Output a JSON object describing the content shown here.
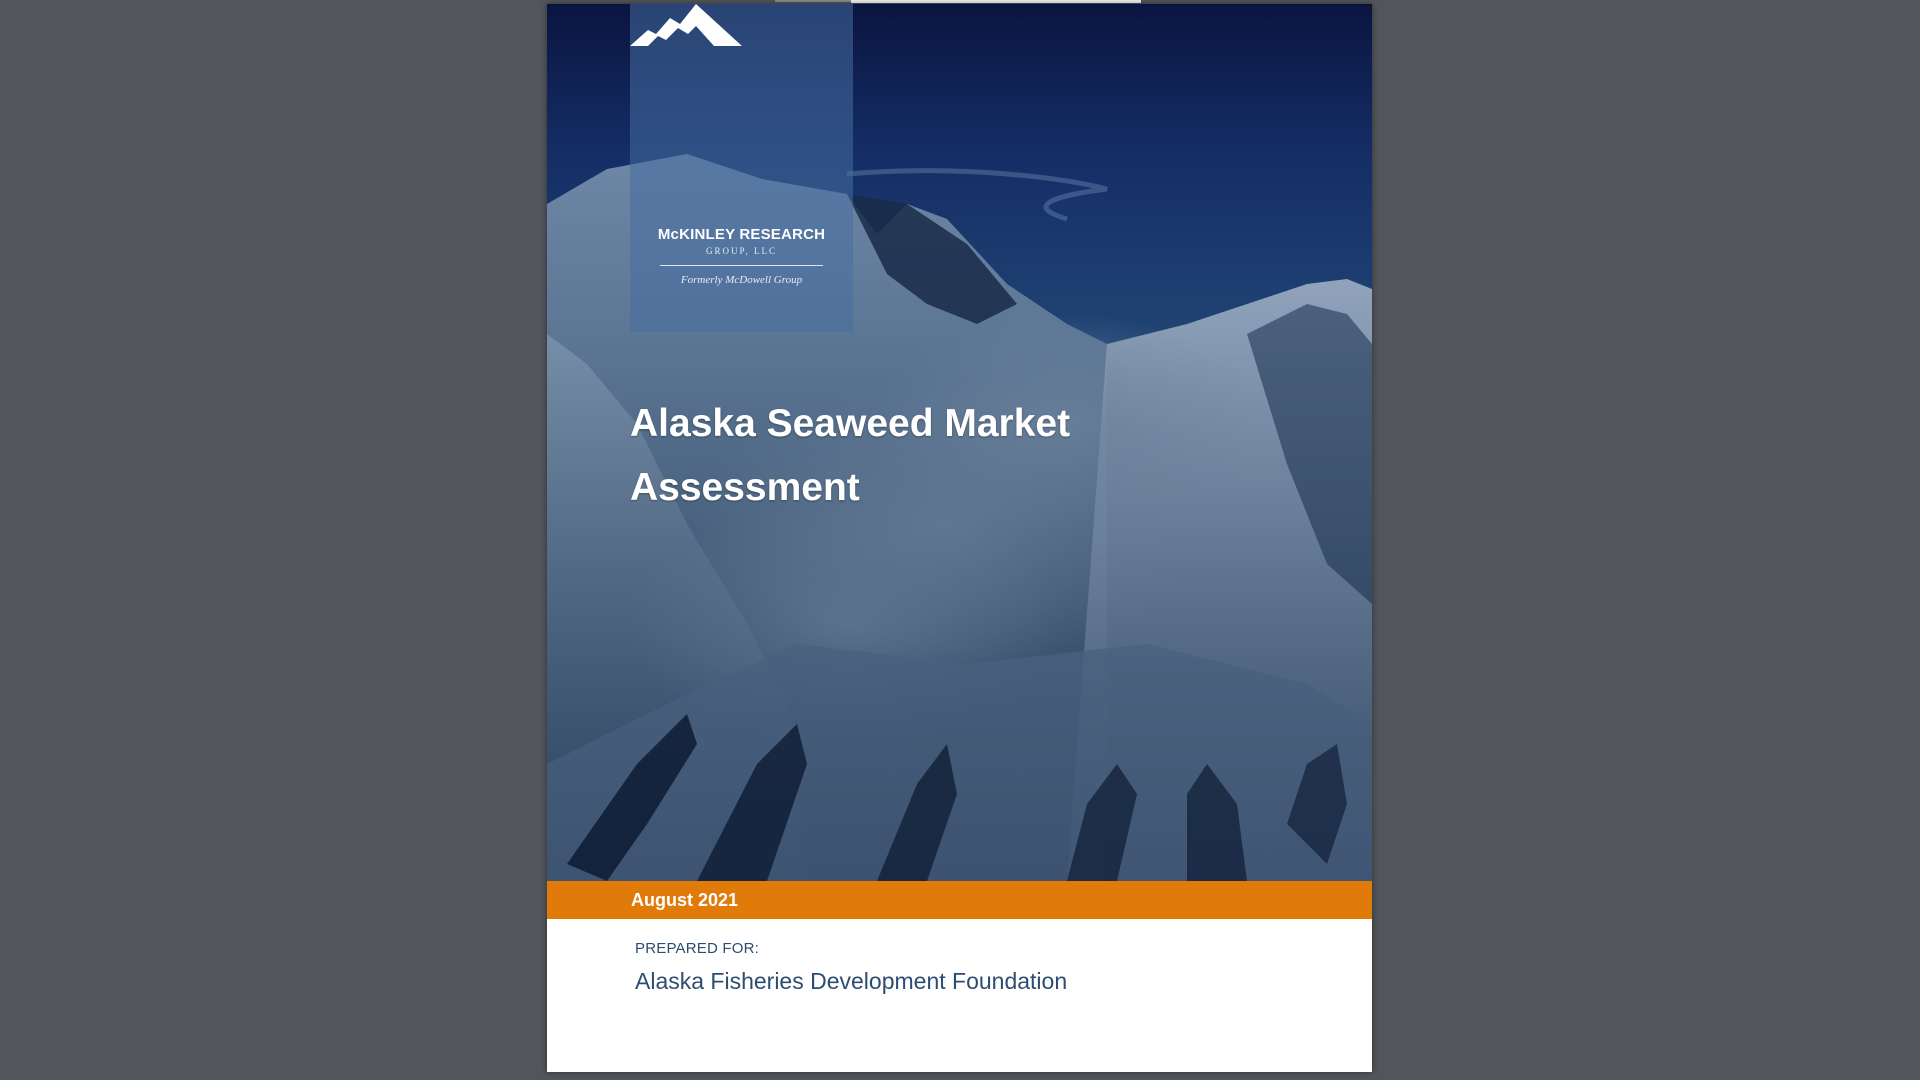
{
  "colors": {
    "viewer_background": "#52565a",
    "accent_orange": "#e07b0a",
    "text_navy": "#2d4d70",
    "cover_sky": "#0a1440"
  },
  "logo": {
    "icon": "mountain-logo-icon",
    "name": "McKINLEY RESEARCH",
    "subtitle": "GROUP, LLC",
    "formerly": "Formerly McDowell Group"
  },
  "cover": {
    "title_line1": "Alaska Seaweed Market",
    "title_line2": "Assessment",
    "date": "August 2021"
  },
  "prepared": {
    "label": "PREPARED FOR:",
    "organization": "Alaska Fisheries Development Foundation"
  }
}
